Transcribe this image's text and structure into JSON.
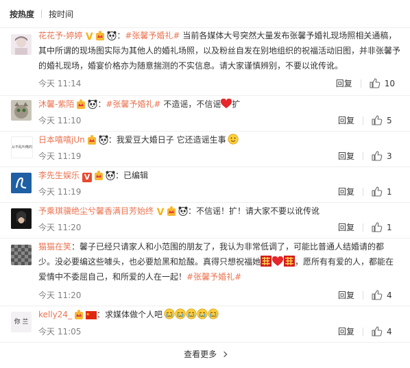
{
  "sort": {
    "hot": "按热度",
    "time": "按时间"
  },
  "labels": {
    "reply": "回复",
    "more": "查看更多"
  },
  "comments": [
    {
      "user": "花花予-婷婷",
      "tag": "#张馨予婚礼#",
      "text": "当前各媒体大号突然大量发布张馨予婚礼现场照相关通稿，其中所谓的现场图实际为其他人的婚礼场照，以及粉丝自发在别地组织的祝福活动旧图，并非张馨予的婚礼现场，婚宴价格亦为随意揣测的不实信息。请大家谨慎辨别，不要以讹传讹。",
      "time": "今天 11:14",
      "likes": "10"
    },
    {
      "user": "沐馨-紫陌",
      "tag": "#张馨予婚礼#",
      "text_a": "不造谣，不信谣",
      "text_b": "扩",
      "time": "今天 11:10",
      "likes": "5"
    },
    {
      "user": "日本嘻嘻jUn",
      "avatar_text": "从不乱叫俺的",
      "text": "我爱豆大婚日子 它还造谣生事",
      "time": "今天 11:19",
      "likes": "3"
    },
    {
      "user": "李先生娱乐",
      "text": "已编辑",
      "time": "今天 11:19",
      "likes": "1"
    },
    {
      "user": "予乘琪骥绝尘兮馨香满目芳始终",
      "text": "不信谣！扩！请大家不要以讹传讹",
      "time": "今天 11:20",
      "likes": "1"
    },
    {
      "user": "猫猫在笑",
      "text_a": "馨子已经只请家人和小范围的朋友了，我认为非常低调了，可能比普通人结婚请的都少。没必要编这些噱头，也必要尬黑和尬酸。真得只想祝福她",
      "text_b": "，愿所有有爱的人，都能在爱情中不委屈自己，和所爱的人在一起！",
      "tag": "#张馨予婚礼#",
      "time": "今天 11:20",
      "likes": "4"
    },
    {
      "user": "kelly24_",
      "avatar_text": "你 兰",
      "text": "求媒体做个人吧",
      "time": "今天 11:05",
      "likes": "4"
    }
  ]
}
